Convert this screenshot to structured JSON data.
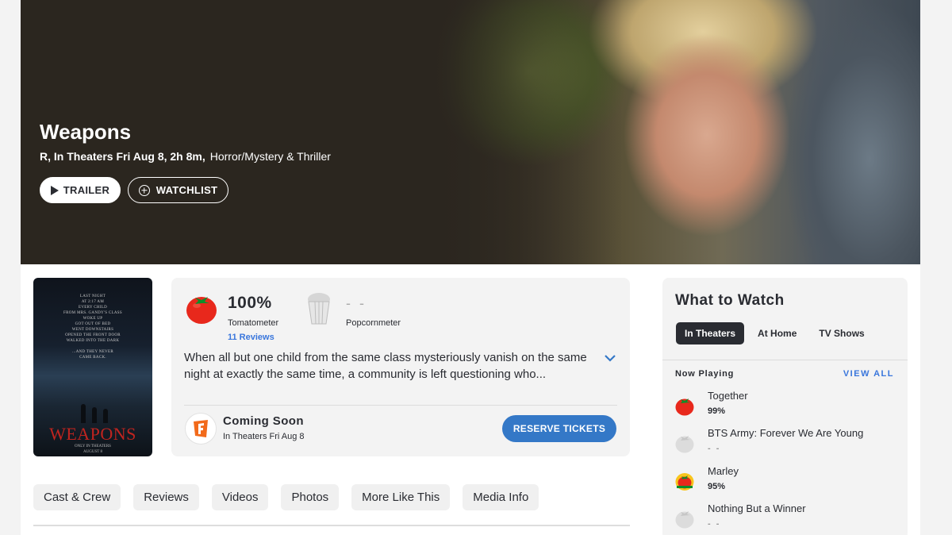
{
  "hero": {
    "title": "Weapons",
    "meta": "R, In Theaters Fri Aug 8, 2h 8m,",
    "genre": "Horror/Mystery & Thriller",
    "trailer_label": "TRAILER",
    "watchlist_label": "WATCHLIST"
  },
  "poster": {
    "tagline_lines": [
      "LAST NIGHT",
      "AT 2:17 AM",
      "EVERY CHILD",
      "FROM MRS. GANDY'S CLASS",
      "WOKE UP",
      "GOT OUT OF BED",
      "WENT DOWNSTAIRS",
      "OPENED THE FRONT DOOR",
      "WALKED INTO THE DARK",
      "",
      "...AND THEY NEVER",
      "CAME BACK."
    ],
    "title": "WEAPONS",
    "date_line1": "ONLY IN THEATERS",
    "date_line2": "AUGUST 8"
  },
  "scores": {
    "tomatometer_value": "100%",
    "tomatometer_label": "Tomatometer",
    "reviews_link": "11 Reviews",
    "popcornmeter_value": "- -",
    "popcornmeter_label": "Popcornmeter",
    "synopsis": "When all but one child from the same class mysteriously vanish on the same night at exactly the same time, a community is left questioning who...",
    "status_title": "Coming Soon",
    "status_sub": "In Theaters Fri Aug 8",
    "reserve_label": "RESERVE TICKETS"
  },
  "tabs": [
    "Cast & Crew",
    "Reviews",
    "Videos",
    "Photos",
    "More Like This",
    "Media Info"
  ],
  "what_to_watch": {
    "title": "What to Watch",
    "tabs": [
      "In Theaters",
      "At Home",
      "TV Shows"
    ],
    "active_tab": "In Theaters",
    "section_label": "Now Playing",
    "view_all": "VIEW ALL",
    "items": [
      {
        "name": "Together",
        "score": "99%",
        "icon": "fresh-tomato-icon"
      },
      {
        "name": "BTS Army: Forever We Are Young",
        "score": "- -",
        "icon": "empty-tomato-icon"
      },
      {
        "name": "Marley",
        "score": "95%",
        "icon": "certified-fresh-icon"
      },
      {
        "name": "Nothing But a Winner",
        "score": "- -",
        "icon": "empty-tomato-icon"
      }
    ]
  },
  "colors": {
    "accent_blue": "#3976dc",
    "button_blue": "#3478c7",
    "tomato_red": "#e8281c",
    "hero_bg": "#2b261f"
  }
}
